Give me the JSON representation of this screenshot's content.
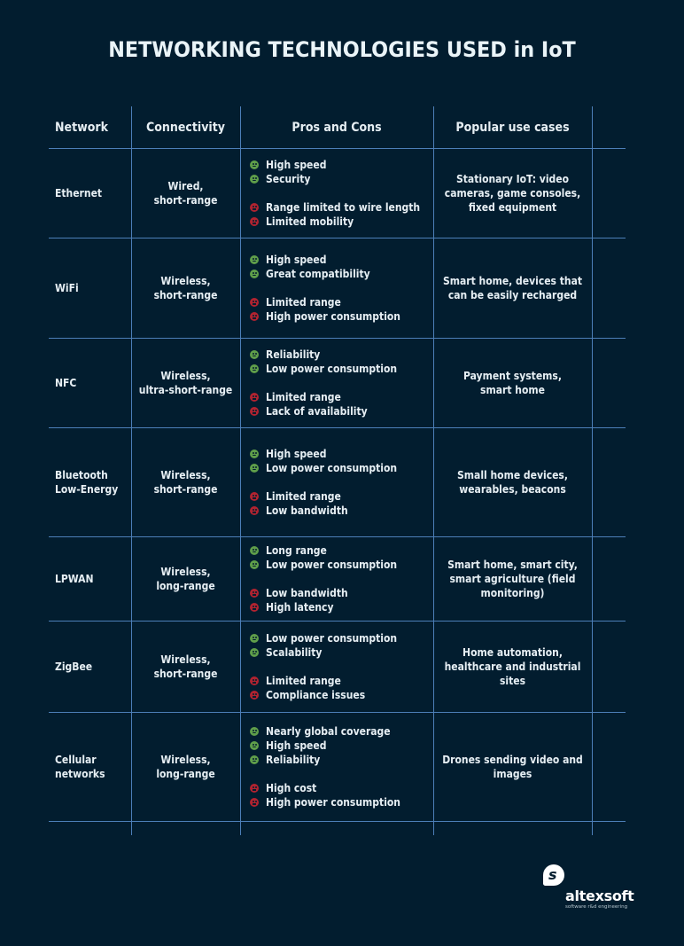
{
  "title": "NETWORKING TECHNOLOGIES USED in IoT",
  "colors": {
    "background": "#021d2f",
    "grid": "#4c7fb8",
    "pro": "#5f9e4a",
    "con": "#b02330",
    "text": "#e6eef3"
  },
  "table": {
    "headers": [
      "Network",
      "Connectivity",
      "Pros and Cons",
      "Popular use cases"
    ],
    "rows": [
      {
        "network": [
          "Ethernet"
        ],
        "connectivity": [
          "Wired,",
          "short-range"
        ],
        "pros": [
          "High speed",
          "Security"
        ],
        "cons": [
          "Range limited to wire length",
          "Limited mobility"
        ],
        "use_cases": [
          "Stationary IoT: video",
          "cameras, game consoles,",
          "fixed equipment"
        ]
      },
      {
        "network": [
          "WiFi"
        ],
        "connectivity": [
          "Wireless,",
          "short-range"
        ],
        "pros": [
          "High speed",
          "Great compatibility"
        ],
        "cons": [
          "Limited range",
          "High power consumption"
        ],
        "use_cases": [
          "Smart home, devices that",
          "can be easily recharged"
        ]
      },
      {
        "network": [
          "NFC"
        ],
        "connectivity": [
          "Wireless,",
          "ultra-short-range"
        ],
        "pros": [
          "Reliability",
          "Low power consumption"
        ],
        "cons": [
          "Limited range",
          "Lack of availability"
        ],
        "use_cases": [
          "Payment systems,",
          "smart home"
        ]
      },
      {
        "network": [
          "Bluetooth",
          "Low-Energy"
        ],
        "connectivity": [
          "Wireless,",
          "short-range"
        ],
        "pros": [
          "High speed",
          "Low power consumption"
        ],
        "cons": [
          "Limited range",
          "Low bandwidth"
        ],
        "use_cases": [
          "Small home devices,",
          "wearables, beacons"
        ]
      },
      {
        "network": [
          "LPWAN"
        ],
        "connectivity": [
          "Wireless,",
          "long-range"
        ],
        "pros": [
          "Long range",
          "Low power consumption"
        ],
        "cons": [
          "Low bandwidth",
          "High latency"
        ],
        "use_cases": [
          "Smart home, smart city,",
          "smart agriculture (field",
          "monitoring)"
        ]
      },
      {
        "network": [
          "ZigBee"
        ],
        "connectivity": [
          "Wireless,",
          "short-range"
        ],
        "pros": [
          "Low power consumption",
          "Scalability"
        ],
        "cons": [
          "Limited range",
          "Compliance issues"
        ],
        "use_cases": [
          "Home automation,",
          "healthcare and industrial",
          "sites"
        ]
      },
      {
        "network": [
          "Cellular",
          "networks"
        ],
        "connectivity": [
          "Wireless,",
          "long-range"
        ],
        "pros": [
          "Nearly global coverage",
          "High speed",
          "Reliability"
        ],
        "cons": [
          "High cost",
          "High power consumption"
        ],
        "use_cases": [
          "Drones sending video and",
          "images"
        ]
      }
    ]
  },
  "icons": {
    "pro": "smiley-face-icon",
    "con": "frown-face-icon"
  },
  "logo": {
    "name": "altexsoft",
    "tagline": "software r&d engineering",
    "mark": "s"
  }
}
